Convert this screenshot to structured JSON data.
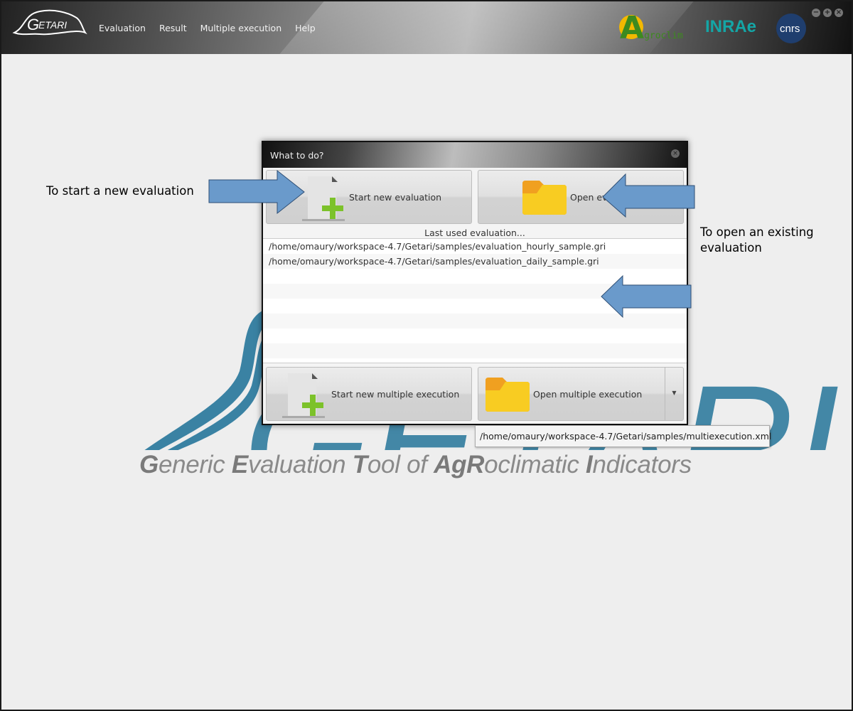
{
  "app": {
    "logo_text": "GETARI",
    "menu": [
      "Evaluation",
      "Result",
      "Multiple execution",
      "Help"
    ],
    "partners": [
      "Agroclim",
      "INRAE",
      "cnrs"
    ],
    "window_controls": [
      "minimize",
      "maximize",
      "close"
    ]
  },
  "background": {
    "logo_text": "GETARI",
    "tagline": [
      {
        "t": "G",
        "b": true
      },
      {
        "t": "eneric ",
        "b": false
      },
      {
        "t": "E",
        "b": true
      },
      {
        "t": "valuation ",
        "b": false
      },
      {
        "t": "T",
        "b": true
      },
      {
        "t": "ool of ",
        "b": false
      },
      {
        "t": "Ag",
        "b": true
      },
      {
        "t": "R",
        "b": true
      },
      {
        "t": "oclimatic ",
        "b": false
      },
      {
        "t": "I",
        "b": true
      },
      {
        "t": "ndicators",
        "b": false
      }
    ]
  },
  "annotations": {
    "left": "To start a new evaluation",
    "right_line1": "To open an existing",
    "right_line2": "evaluation",
    "arrow_color": "#6a9acb"
  },
  "dialog": {
    "title": "What to do?",
    "start_new": "Start new evaluation",
    "open": "Open evaluation",
    "last_used_label": "Last used evaluation...",
    "recent": [
      "/home/omaury/workspace-4.7/Getari/samples/evaluation_hourly_sample.gri",
      "/home/omaury/workspace-4.7/Getari/samples/evaluation_daily_sample.gri",
      "",
      "",
      "",
      "",
      "",
      "",
      ""
    ],
    "start_multi": "Start new multiple execution",
    "open_multi": "Open multiple execution"
  },
  "tooltip": "/home/omaury/workspace-4.7/Getari/samples/multiexecution.xml"
}
